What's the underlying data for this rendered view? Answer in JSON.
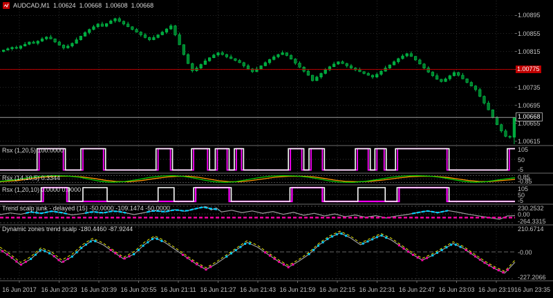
{
  "header": {
    "symbol": "AUDCAD,M1",
    "open": "1.00624",
    "high": "1.00668",
    "low": "1.00608",
    "close": "1.00668"
  },
  "colors": {
    "background": "#000000",
    "candle_up": "#00A83D",
    "candle_border": "#00C24A",
    "candle_down": "#00802C",
    "red_line": "#C00000",
    "bid_line": "#9E9E9E",
    "white_buffer": "#FFFFFF",
    "magenta_buffer": "#FF00FF",
    "green_buffer": "#00C800",
    "orange_buffer": "#FF9900",
    "gray_buffer": "#A0A0A0",
    "cyan_buffer": "#00CFFF",
    "pink_buffer": "#FF00AA",
    "yellow_buffer": "#E8E800",
    "grid": "#2B2B2B",
    "separator": "#6E6E6E",
    "axis_text": "#C0C0C0"
  },
  "time_axis": {
    "labels": [
      "16 Jun 2017",
      "16 Jun 20:23",
      "16 Jun 20:39",
      "16 Jun 20:55",
      "16 Jun 21:11",
      "16 Jun 21:27",
      "16 Jun 21:43",
      "16 Jun 21:59",
      "16 Jun 22:15",
      "16 Jun 22:31",
      "16 Jun 22:47",
      "16 Jun 23:03",
      "16 Jun 23:19",
      "16 Jun 23:35"
    ]
  },
  "chart_data": [
    {
      "type": "candlestick",
      "title": "AUDCAD,M1",
      "y_ticks": [
        "1.00895",
        "1.00855",
        "1.00815",
        "1.00775",
        "1.00735",
        "1.00695",
        "1.00655",
        "1.00615"
      ],
      "price_top": 1.00928,
      "price_bottom": 1.00607,
      "pip_size": 1e-05,
      "red_hline": {
        "price": 1.00775,
        "label": "1.00775"
      },
      "bid_line": {
        "price": 1.00668,
        "label": "1.00668"
      },
      "last_candle": {
        "open": 1.00624,
        "high": 1.00668,
        "low": 1.00608,
        "close": 1.00668
      },
      "closes_pips": [
        818,
        821,
        824,
        822,
        827,
        831,
        836,
        833,
        838,
        843,
        847,
        843,
        836,
        829,
        823,
        827,
        833,
        841,
        849,
        857,
        864,
        870,
        876,
        871,
        877,
        883,
        888,
        882,
        876,
        870,
        864,
        858,
        852,
        846,
        841,
        846,
        852,
        858,
        865,
        872,
        852,
        830,
        808,
        788,
        772,
        778,
        786,
        794,
        801,
        807,
        812,
        808,
        803,
        799,
        795,
        790,
        783,
        776,
        770,
        776,
        783,
        790,
        797,
        803,
        808,
        812,
        806,
        798,
        789,
        780,
        771,
        762,
        750,
        758,
        766,
        774,
        781,
        787,
        792,
        788,
        783,
        778,
        774,
        770,
        766,
        762,
        758,
        764,
        771,
        778,
        785,
        792,
        799,
        805,
        810,
        804,
        796,
        787,
        778,
        769,
        761,
        753,
        748,
        754,
        761,
        768,
        762,
        754,
        746,
        738,
        730,
        715,
        700,
        685,
        668,
        652,
        638,
        626,
        624,
        668
      ]
    },
    {
      "type": "step-line",
      "label": "Rsx (1,20,5) 100.0000",
      "ylim": [
        -5,
        105
      ],
      "axis": [
        "105",
        "50",
        "-5"
      ],
      "white_high": [
        [
          0.072,
          0.127
        ],
        [
          0.157,
          0.205
        ],
        [
          0.303,
          0.335
        ],
        [
          0.372,
          0.407
        ],
        [
          0.418,
          0.445
        ],
        [
          0.455,
          0.473
        ],
        [
          0.56,
          0.59
        ],
        [
          0.6,
          0.63
        ],
        [
          0.69,
          0.719
        ],
        [
          0.728,
          0.75
        ],
        [
          0.768,
          0.872
        ],
        [
          0.985,
          1.0
        ]
      ],
      "magenta_high": [
        [
          0.076,
          0.123
        ],
        [
          0.161,
          0.201
        ],
        [
          0.307,
          0.331
        ],
        [
          0.376,
          0.403
        ],
        [
          0.422,
          0.441
        ],
        [
          0.459,
          0.469
        ],
        [
          0.564,
          0.586
        ],
        [
          0.604,
          0.626
        ],
        [
          0.694,
          0.715
        ],
        [
          0.732,
          0.746
        ],
        [
          0.772,
          0.868
        ],
        [
          0.989,
          1.0
        ]
      ]
    },
    {
      "type": "line",
      "label": "Rsx (14,10,5) 0.3344",
      "ylim": [
        -1,
        1
      ],
      "axis": [
        "0.85",
        "-0.85"
      ],
      "green": [
        [
          0,
          -0.6
        ],
        [
          0.03,
          -0.2
        ],
        [
          0.055,
          0.35
        ],
        [
          0.08,
          0.75
        ],
        [
          0.105,
          0.9
        ],
        [
          0.13,
          0.8
        ],
        [
          0.155,
          0.45
        ],
        [
          0.175,
          -0.1
        ],
        [
          0.195,
          -0.6
        ],
        [
          0.215,
          -0.85
        ],
        [
          0.24,
          -0.7
        ],
        [
          0.265,
          -0.2
        ],
        [
          0.29,
          0.4
        ],
        [
          0.315,
          0.8
        ],
        [
          0.335,
          0.9
        ],
        [
          0.355,
          0.7
        ],
        [
          0.375,
          0.3
        ],
        [
          0.395,
          -0.25
        ],
        [
          0.415,
          -0.7
        ],
        [
          0.435,
          -0.88
        ],
        [
          0.455,
          -0.75
        ],
        [
          0.475,
          -0.3
        ],
        [
          0.5,
          0.3
        ],
        [
          0.525,
          0.75
        ],
        [
          0.55,
          0.9
        ],
        [
          0.575,
          0.8
        ],
        [
          0.6,
          0.45
        ],
        [
          0.62,
          0
        ],
        [
          0.64,
          -0.5
        ],
        [
          0.66,
          -0.82
        ],
        [
          0.685,
          -0.88
        ],
        [
          0.71,
          -0.6
        ],
        [
          0.735,
          -0.1
        ],
        [
          0.76,
          0.45
        ],
        [
          0.785,
          0.82
        ],
        [
          0.81,
          0.9
        ],
        [
          0.835,
          0.75
        ],
        [
          0.86,
          0.35
        ],
        [
          0.88,
          -0.15
        ],
        [
          0.9,
          -0.6
        ],
        [
          0.92,
          -0.85
        ],
        [
          0.94,
          -0.75
        ],
        [
          0.96,
          -0.4
        ],
        [
          0.98,
          0
        ],
        [
          1,
          0.33
        ]
      ],
      "orange": [
        [
          0,
          -0.7
        ],
        [
          0.035,
          -0.4
        ],
        [
          0.06,
          0.1
        ],
        [
          0.085,
          0.5
        ],
        [
          0.11,
          0.72
        ],
        [
          0.135,
          0.75
        ],
        [
          0.16,
          0.55
        ],
        [
          0.185,
          0.1
        ],
        [
          0.205,
          -0.35
        ],
        [
          0.225,
          -0.65
        ],
        [
          0.25,
          -0.72
        ],
        [
          0.275,
          -0.4
        ],
        [
          0.3,
          0.1
        ],
        [
          0.325,
          0.55
        ],
        [
          0.345,
          0.72
        ],
        [
          0.365,
          0.72
        ],
        [
          0.385,
          0.45
        ],
        [
          0.405,
          0
        ],
        [
          0.425,
          -0.45
        ],
        [
          0.445,
          -0.7
        ],
        [
          0.465,
          -0.72
        ],
        [
          0.485,
          -0.45
        ],
        [
          0.51,
          0
        ],
        [
          0.535,
          0.5
        ],
        [
          0.56,
          0.72
        ],
        [
          0.585,
          0.74
        ],
        [
          0.61,
          0.55
        ],
        [
          0.63,
          0.15
        ],
        [
          0.65,
          -0.3
        ],
        [
          0.67,
          -0.62
        ],
        [
          0.695,
          -0.72
        ],
        [
          0.72,
          -0.6
        ],
        [
          0.745,
          -0.25
        ],
        [
          0.77,
          0.2
        ],
        [
          0.795,
          0.6
        ],
        [
          0.82,
          0.74
        ],
        [
          0.845,
          0.68
        ],
        [
          0.87,
          0.4
        ],
        [
          0.89,
          0
        ],
        [
          0.91,
          -0.4
        ],
        [
          0.93,
          -0.65
        ],
        [
          0.95,
          -0.68
        ],
        [
          0.97,
          -0.45
        ],
        [
          1,
          -0.1
        ]
      ]
    },
    {
      "type": "step-line",
      "label": "Rsx (1,20,10) 0.0000 0.0000",
      "ylim": [
        -5,
        105
      ],
      "axis": [
        "105",
        "50",
        "-5"
      ],
      "white_high": [
        [
          0.08,
          0.134
        ],
        [
          0.161,
          0.208
        ],
        [
          0.307,
          0.338
        ],
        [
          0.376,
          0.449
        ],
        [
          0.563,
          0.63
        ],
        [
          0.695,
          0.748
        ],
        [
          0.771,
          0.872
        ]
      ],
      "magenta_high": [
        [
          0.084,
          0.13
        ],
        [
          0.38,
          0.445
        ],
        [
          0.567,
          0.626
        ],
        [
          0.775,
          0.868
        ]
      ]
    },
    {
      "type": "line",
      "label": "Trend scalp junk - delayed (15) -50.0000 -109.1474 -50.0000",
      "ylim": [
        -264.3315,
        230.2532
      ],
      "axis": [
        "230.2532",
        "0.00",
        "-264.3315"
      ],
      "gray": [
        [
          0,
          -20
        ],
        [
          0.02,
          30
        ],
        [
          0.04,
          -10
        ],
        [
          0.06,
          60
        ],
        [
          0.08,
          20
        ],
        [
          0.1,
          80
        ],
        [
          0.12,
          40
        ],
        [
          0.14,
          -30
        ],
        [
          0.16,
          10
        ],
        [
          0.18,
          70
        ],
        [
          0.2,
          30
        ],
        [
          0.22,
          90
        ],
        [
          0.24,
          50
        ],
        [
          0.26,
          -20
        ],
        [
          0.28,
          40
        ],
        [
          0.3,
          100
        ],
        [
          0.32,
          60
        ],
        [
          0.34,
          130
        ],
        [
          0.36,
          80
        ],
        [
          0.38,
          160
        ],
        [
          0.4,
          220
        ],
        [
          0.41,
          120
        ],
        [
          0.42,
          180
        ],
        [
          0.43,
          60
        ],
        [
          0.45,
          110
        ],
        [
          0.47,
          40
        ],
        [
          0.49,
          90
        ],
        [
          0.51,
          20
        ],
        [
          0.53,
          70
        ],
        [
          0.55,
          -10
        ],
        [
          0.57,
          50
        ],
        [
          0.59,
          -40
        ],
        [
          0.61,
          20
        ],
        [
          0.63,
          -60
        ],
        [
          0.65,
          0
        ],
        [
          0.67,
          -80
        ],
        [
          0.69,
          -30
        ],
        [
          0.71,
          -100
        ],
        [
          0.73,
          -50
        ],
        [
          0.75,
          -120
        ],
        [
          0.77,
          -60
        ],
        [
          0.79,
          -20
        ],
        [
          0.81,
          40
        ],
        [
          0.83,
          90
        ],
        [
          0.85,
          40
        ],
        [
          0.87,
          100
        ],
        [
          0.89,
          50
        ],
        [
          0.91,
          -10
        ],
        [
          0.93,
          -60
        ],
        [
          0.95,
          -110
        ],
        [
          0.97,
          -160
        ],
        [
          0.985,
          -60
        ],
        [
          1,
          -50
        ]
      ],
      "cyan_ranges": [
        [
          0.05,
          0.135
        ],
        [
          0.165,
          0.255
        ],
        [
          0.285,
          0.435
        ],
        [
          0.8,
          0.88
        ]
      ],
      "magenta_level": -109.1474
    },
    {
      "type": "line",
      "label": "Dynamic zones trend scalp -180.4460 -87.9244",
      "ylim": [
        -227.2066,
        210.6714
      ],
      "axis": [
        "210.6714",
        "-0.00",
        "-227.2066"
      ],
      "gray": [
        [
          0,
          20
        ],
        [
          0.02,
          -40
        ],
        [
          0.04,
          -110
        ],
        [
          0.06,
          -60
        ],
        [
          0.08,
          20
        ],
        [
          0.1,
          -20
        ],
        [
          0.12,
          -90
        ],
        [
          0.14,
          -40
        ],
        [
          0.16,
          40
        ],
        [
          0.18,
          100
        ],
        [
          0.2,
          60
        ],
        [
          0.22,
          0
        ],
        [
          0.24,
          -60
        ],
        [
          0.26,
          -20
        ],
        [
          0.28,
          60
        ],
        [
          0.3,
          120
        ],
        [
          0.32,
          80
        ],
        [
          0.34,
          20
        ],
        [
          0.36,
          -40
        ],
        [
          0.38,
          -100
        ],
        [
          0.4,
          -150
        ],
        [
          0.42,
          -100
        ],
        [
          0.44,
          -40
        ],
        [
          0.46,
          20
        ],
        [
          0.48,
          80
        ],
        [
          0.5,
          40
        ],
        [
          0.52,
          -20
        ],
        [
          0.54,
          -80
        ],
        [
          0.56,
          -130
        ],
        [
          0.58,
          -80
        ],
        [
          0.6,
          -20
        ],
        [
          0.62,
          60
        ],
        [
          0.64,
          120
        ],
        [
          0.66,
          160
        ],
        [
          0.68,
          120
        ],
        [
          0.7,
          60
        ],
        [
          0.72,
          100
        ],
        [
          0.74,
          140
        ],
        [
          0.76,
          100
        ],
        [
          0.78,
          40
        ],
        [
          0.8,
          -20
        ],
        [
          0.82,
          -70
        ],
        [
          0.84,
          -30
        ],
        [
          0.86,
          20
        ],
        [
          0.88,
          70
        ],
        [
          0.9,
          30
        ],
        [
          0.92,
          -30
        ],
        [
          0.94,
          -90
        ],
        [
          0.96,
          -140
        ],
        [
          0.98,
          -180
        ],
        [
          1,
          -88
        ]
      ],
      "yellow": [
        [
          0,
          40
        ],
        [
          0.02,
          -20
        ],
        [
          0.04,
          -90
        ],
        [
          0.06,
          -40
        ],
        [
          0.08,
          35
        ],
        [
          0.1,
          0
        ],
        [
          0.12,
          -70
        ],
        [
          0.14,
          -20
        ],
        [
          0.16,
          60
        ],
        [
          0.18,
          115
        ],
        [
          0.2,
          75
        ],
        [
          0.22,
          15
        ],
        [
          0.24,
          -45
        ],
        [
          0.26,
          0
        ],
        [
          0.28,
          80
        ],
        [
          0.3,
          135
        ],
        [
          0.32,
          95
        ],
        [
          0.34,
          35
        ],
        [
          0.36,
          -25
        ],
        [
          0.38,
          -85
        ],
        [
          0.4,
          -135
        ],
        [
          0.42,
          -85
        ],
        [
          0.44,
          -25
        ],
        [
          0.46,
          35
        ],
        [
          0.48,
          95
        ],
        [
          0.5,
          55
        ],
        [
          0.52,
          -5
        ],
        [
          0.54,
          -65
        ],
        [
          0.56,
          -115
        ],
        [
          0.58,
          -65
        ],
        [
          0.6,
          -5
        ],
        [
          0.62,
          75
        ],
        [
          0.64,
          135
        ],
        [
          0.66,
          175
        ],
        [
          0.68,
          135
        ],
        [
          0.7,
          75
        ],
        [
          0.72,
          115
        ],
        [
          0.74,
          155
        ],
        [
          0.76,
          115
        ],
        [
          0.78,
          55
        ],
        [
          0.8,
          -5
        ],
        [
          0.82,
          -55
        ],
        [
          0.84,
          -15
        ],
        [
          0.86,
          35
        ],
        [
          0.88,
          85
        ],
        [
          0.9,
          45
        ],
        [
          0.92,
          -15
        ],
        [
          0.94,
          -75
        ],
        [
          0.96,
          -125
        ],
        [
          0.98,
          -165
        ],
        [
          1,
          -70
        ]
      ],
      "cyan_ranges": [
        [
          0.06,
          0.105
        ],
        [
          0.14,
          0.19
        ],
        [
          0.26,
          0.315
        ],
        [
          0.44,
          0.49
        ],
        [
          0.6,
          0.675
        ],
        [
          0.705,
          0.755
        ],
        [
          0.84,
          0.895
        ]
      ],
      "magenta_ranges": [
        [
          0.005,
          0.05
        ],
        [
          0.105,
          0.135
        ],
        [
          0.215,
          0.255
        ],
        [
          0.355,
          0.415
        ],
        [
          0.515,
          0.575
        ],
        [
          0.775,
          0.835
        ],
        [
          0.905,
          0.99
        ]
      ]
    }
  ]
}
